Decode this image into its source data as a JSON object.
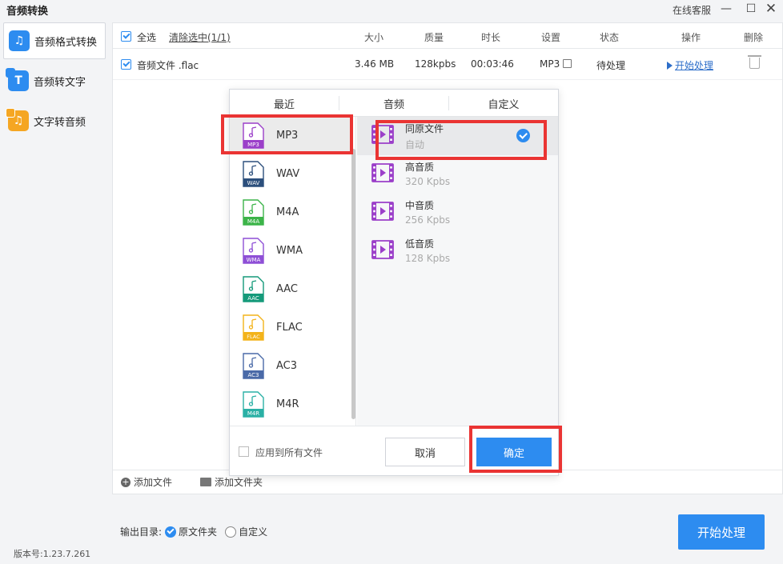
{
  "window": {
    "title": "音频转换",
    "support": "在线客服",
    "minimize": "—",
    "maximize": "☐",
    "close": "✕"
  },
  "sidebar": {
    "items": [
      {
        "label": "音频格式转换",
        "icon": "music-note-icon",
        "color": "#2d8cf0",
        "glyph": "♫",
        "active": true
      },
      {
        "label": "音频转文字",
        "icon": "text-t-icon",
        "color": "#2d8cf0",
        "glyph": "T",
        "active": false
      },
      {
        "label": "文字转音频",
        "icon": "music-file-icon",
        "color": "#f5a623",
        "glyph": "♫",
        "active": false
      }
    ],
    "version": "版本号:1.23.7.261"
  },
  "table": {
    "select_all": "全选",
    "clear_selected": "清除选中(1/1)",
    "headers": {
      "size": "大小",
      "quality": "质量",
      "duration": "时长",
      "settings": "设置",
      "status": "状态",
      "action": "操作",
      "delete": "删除"
    },
    "rows": [
      {
        "name": "音频文件 .flac",
        "size": "3.46 MB",
        "quality": "128kpbs",
        "duration": "00:03:46",
        "format": "MP3",
        "status": "待处理",
        "action": "开始处理"
      }
    ]
  },
  "footer": {
    "add_file": "添加文件",
    "add_folder": "添加文件夹"
  },
  "output": {
    "label": "输出目录:",
    "option_source": "原文件夹",
    "option_custom": "自定义"
  },
  "start_button": "开始处理",
  "dialog": {
    "tabs": [
      "最近",
      "音频",
      "自定义"
    ],
    "formats": [
      {
        "name": "MP3",
        "color": "#9b3fc9",
        "active": true
      },
      {
        "name": "WAV",
        "color": "#2c4f7c",
        "active": false
      },
      {
        "name": "M4A",
        "color": "#3cb449",
        "active": false
      },
      {
        "name": "WMA",
        "color": "#8e4fd6",
        "active": false
      },
      {
        "name": "AAC",
        "color": "#159a7a",
        "active": false
      },
      {
        "name": "FLAC",
        "color": "#f3b31a",
        "active": false
      },
      {
        "name": "AC3",
        "color": "#4a6aa8",
        "active": false
      },
      {
        "name": "M4R",
        "color": "#2ab0a5",
        "active": false
      }
    ],
    "qualities": [
      {
        "title": "同原文件",
        "sub": "自动",
        "active": true
      },
      {
        "title": "高音质",
        "sub": "320 Kpbs",
        "active": false
      },
      {
        "title": "中音质",
        "sub": "256 Kpbs",
        "active": false
      },
      {
        "title": "低音质",
        "sub": "128 Kpbs",
        "active": false
      }
    ],
    "apply_all": "应用到所有文件",
    "cancel": "取消",
    "ok": "确定"
  },
  "colors": {
    "accent": "#2d8cf0",
    "highlight": "#ea3433",
    "quality_icon": "#9b3fc9"
  }
}
